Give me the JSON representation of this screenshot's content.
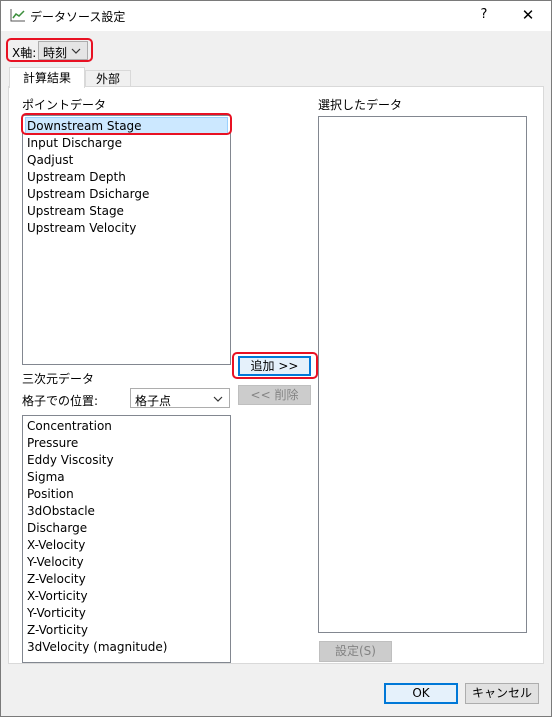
{
  "window": {
    "title": "データソース設定",
    "help_label": "?",
    "close_label": "✕"
  },
  "xaxis": {
    "label": "X軸:",
    "value": "時刻"
  },
  "tabs": [
    {
      "label": "計算結果",
      "active": true
    },
    {
      "label": "外部",
      "active": false
    }
  ],
  "point_data": {
    "header": "ポイントデータ",
    "items": [
      "Downstream Stage",
      "Input Discharge",
      "Qadjust",
      "Upstream Depth",
      "Upstream Dsicharge",
      "Upstream Stage",
      "Upstream Velocity"
    ],
    "selected": "Downstream Stage"
  },
  "selected_data": {
    "header": "選択したデータ"
  },
  "buttons": {
    "add": "追加 >>",
    "remove": "<< 削除",
    "settings": "設定(S)",
    "ok": "OK",
    "cancel": "キャンセル"
  },
  "three_d": {
    "header": "三次元データ",
    "position_label": "格子での位置:",
    "position_value": "格子点",
    "items": [
      "Concentration",
      "Pressure",
      "Eddy Viscosity",
      "Sigma",
      "Position",
      "3dObstacle",
      "Discharge",
      "X-Velocity",
      "Y-Velocity",
      "Z-Velocity",
      "X-Vorticity",
      "Y-Vorticity",
      "Z-Vorticity",
      "3dVelocity (magnitude)"
    ]
  },
  "colors": {
    "highlight": "#e81123",
    "selection": "#cce8ff",
    "default_button_border": "#0078d7"
  },
  "icons": {
    "app": "chart-line-icon",
    "dropdown": "chevron-down-icon"
  }
}
